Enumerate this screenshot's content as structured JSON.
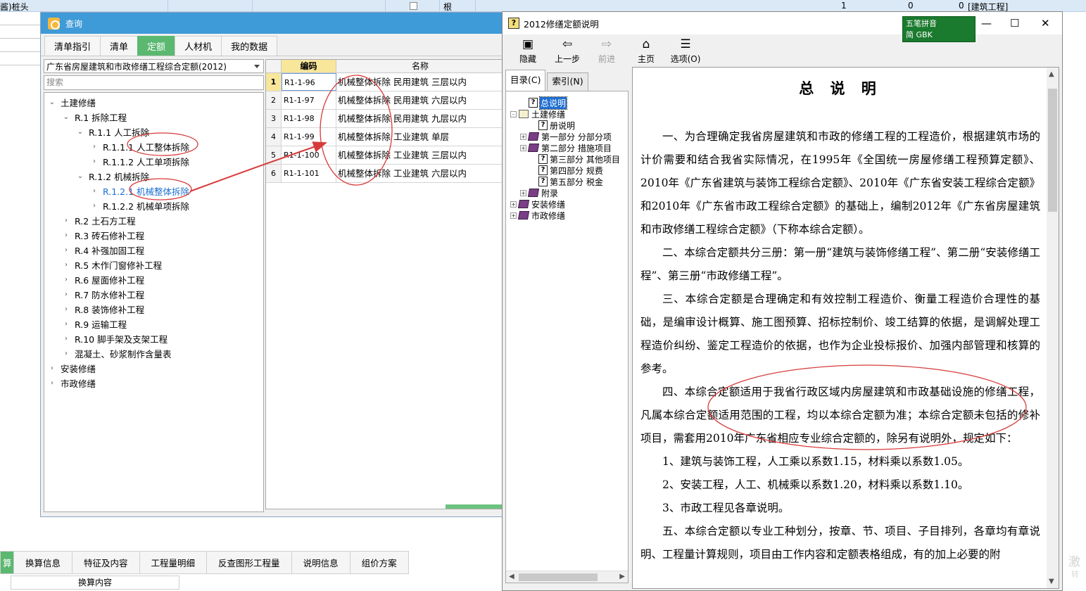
{
  "background_sheet": {
    "row_text": "酱)桩头",
    "unit": "根",
    "qty": "1",
    "value": "0",
    "value2": "0",
    "category": "[建筑工程]"
  },
  "query_window": {
    "title": "查询",
    "tabs": [
      "清单指引",
      "清单",
      "定额",
      "人材机",
      "我的数据"
    ],
    "active_tab": "定额",
    "quota_library": "广东省房屋建筑和市政修缮工程综合定额(2012)",
    "search_placeholder": "搜索",
    "tree": [
      {
        "label": "土建修缮",
        "level": 0,
        "expanded": true
      },
      {
        "label": "R.1 拆除工程",
        "level": 1,
        "expanded": true
      },
      {
        "label": "R.1.1 人工拆除",
        "level": 2,
        "expanded": true
      },
      {
        "label": "R.1.1.1 人工整体拆除",
        "level": 3,
        "expanded": false
      },
      {
        "label": "R.1.1.2 人工单项拆除",
        "level": 3,
        "expanded": false
      },
      {
        "label": "R.1.2 机械拆除",
        "level": 2,
        "expanded": true
      },
      {
        "label": "R.1.2.1 机械整体拆除",
        "level": 3,
        "expanded": false,
        "selected": true
      },
      {
        "label": "R.1.2.2 机械单项拆除",
        "level": 3,
        "expanded": false
      },
      {
        "label": "R.2 土石方工程",
        "level": 1,
        "expanded": false
      },
      {
        "label": "R.3 砖石修补工程",
        "level": 1,
        "expanded": false
      },
      {
        "label": "R.4 补强加固工程",
        "level": 1,
        "expanded": false
      },
      {
        "label": "R.5 木作门窗修补工程",
        "level": 1,
        "expanded": false
      },
      {
        "label": "R.6 屋面修补工程",
        "level": 1,
        "expanded": false
      },
      {
        "label": "R.7 防水修补工程",
        "level": 1,
        "expanded": false
      },
      {
        "label": "R.8 装饰修补工程",
        "level": 1,
        "expanded": false
      },
      {
        "label": "R.9 运输工程",
        "level": 1,
        "expanded": false
      },
      {
        "label": "R.10 脚手架及支架工程",
        "level": 1,
        "expanded": false
      },
      {
        "label": "混凝土、砂浆制作含量表",
        "level": 1,
        "expanded": false
      },
      {
        "label": "安装修缮",
        "level": 0,
        "expanded": false
      },
      {
        "label": "市政修缮",
        "level": 0,
        "expanded": false
      }
    ],
    "grid": {
      "headers": {
        "code": "编码",
        "name": "名称"
      },
      "rows": [
        {
          "idx": "1",
          "code": "R1-1-96",
          "name": "机械整体拆除 民用建筑 三层以内"
        },
        {
          "idx": "2",
          "code": "R1-1-97",
          "name": "机械整体拆除 民用建筑 六层以内"
        },
        {
          "idx": "3",
          "code": "R1-1-98",
          "name": "机械整体拆除 民用建筑 九层以内"
        },
        {
          "idx": "4",
          "code": "R1-1-99",
          "name": "机械整体拆除 工业建筑 单层"
        },
        {
          "idx": "5",
          "code": "R1-1-100",
          "name": "机械整体拆除 工业建筑 三层以内"
        },
        {
          "idx": "6",
          "code": "R1-1-101",
          "name": "机械整体拆除 工业建筑 六层以内"
        }
      ]
    }
  },
  "bottom_tabs": {
    "items": [
      "算",
      "换算信息",
      "特征及内容",
      "工程量明细",
      "反查图形工程量",
      "说明信息",
      "组价方案"
    ],
    "sub_label": "换算内容"
  },
  "help_window": {
    "title": "2012修缮定额说明",
    "toolbar": [
      {
        "label": "隐藏",
        "icon": "hide-icon",
        "enabled": true
      },
      {
        "label": "上一步",
        "icon": "back-icon",
        "enabled": true
      },
      {
        "label": "前进",
        "icon": "forward-icon",
        "enabled": false
      },
      {
        "label": "主页",
        "icon": "home-icon",
        "enabled": true
      },
      {
        "label": "选项(O)",
        "icon": "options-icon",
        "enabled": true
      }
    ],
    "nav_tabs": [
      "目录(C)",
      "索引(N)"
    ],
    "toc": [
      {
        "label": "总说明",
        "type": "topic",
        "indent": 1,
        "selected": true
      },
      {
        "label": "土建修缮",
        "type": "open-book",
        "indent": 0,
        "toggle": "-"
      },
      {
        "label": "册说明",
        "type": "topic",
        "indent": 2
      },
      {
        "label": "第一部分 分部分项",
        "type": "book",
        "indent": 1,
        "toggle": "+"
      },
      {
        "label": "第二部分 措施项目",
        "type": "book",
        "indent": 1,
        "toggle": "+"
      },
      {
        "label": "第三部分 其他项目",
        "type": "topic",
        "indent": 2
      },
      {
        "label": "第四部分 规费",
        "type": "topic",
        "indent": 2
      },
      {
        "label": "第五部分 税金",
        "type": "topic",
        "indent": 2
      },
      {
        "label": "附录",
        "type": "book",
        "indent": 1,
        "toggle": "+"
      },
      {
        "label": "安装修缮",
        "type": "book",
        "indent": 0,
        "toggle": "+"
      },
      {
        "label": "市政修缮",
        "type": "book",
        "indent": 0,
        "toggle": "+"
      }
    ],
    "ime": {
      "line1": "五笔拼音",
      "line2": "简 GBK"
    },
    "content": {
      "heading": "总 说 明",
      "paragraphs": [
        "一、为合理确定我省房屋建筑和市政的修缮工程的工程造价，根据建筑市场的计价需要和结合我省实际情况，在1995年《全国统一房屋修缮工程预算定额》、2010年《广东省建筑与装饰工程综合定额》、2010年《广东省安装工程综合定额》和2010年《广东省市政工程综合定额》的基础上，编制2012年《广东省房屋建筑和市政修缮工程综合定额》（下称本综合定额）。",
        "二、本综合定额共分三册：第一册“建筑与装饰修缮工程”、第二册“安装修缮工程”、第三册“市政修缮工程”。",
        "三、本综合定额是合理确定和有效控制工程造价、衡量工程造价合理性的基础，是编审设计概算、施工图预算、招标控制价、竣工结算的依据，是调解处理工程造价纠纷、鉴定工程造价的依据，也作为企业投标报价、加强内部管理和核算的参考。",
        "四、本综合定额适用于我省行政区域内房屋建筑和市政基础设施的修缮工程，凡属本综合定额适用范围的工程，均以本综合定额为准；本综合定额未包括的修补项目，需套用2010年广东省相应专业综合定额的，除另有说明外，规定如下：",
        "1、建筑与装饰工程，人工乘以系数1.15，材料乘以系数1.05。",
        "2、安装工程，人工、机械乘以系数1.20，材料乘以系数1.10。",
        "3、市政工程见各章说明。",
        "五、本综合定额以专业工种划分，按章、节、项目、子目排列，各章均有章说明、工程量计算规则，项目由工作内容和定额表格组成，有的加上必要的附"
      ]
    }
  },
  "watermark": {
    "text": "激",
    "sub": "转"
  }
}
